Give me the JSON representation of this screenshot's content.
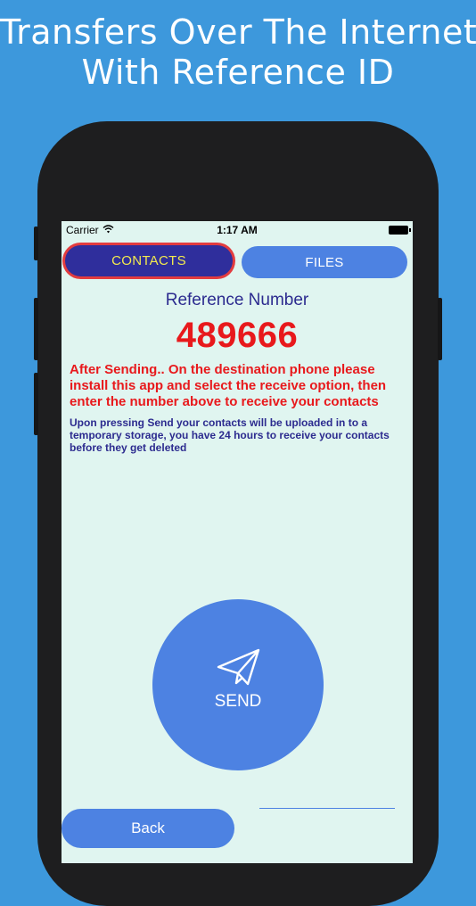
{
  "headline": {
    "line1": "Transfers Over The Internet",
    "line2": "With Reference ID"
  },
  "status_bar": {
    "carrier": "Carrier",
    "time": "1:17 AM"
  },
  "tabs": [
    {
      "label": "CONTACTS",
      "selected": true
    },
    {
      "label": "FILES",
      "selected": false
    }
  ],
  "reference": {
    "label": "Reference Number",
    "number": "489666"
  },
  "warning_text": "After Sending.. On the destination phone please install this app and select the receive option, then enter the number above to receive your contacts",
  "info_text": "Upon pressing Send your contacts will be uploaded in to a temporary storage, you have 24 hours to receive your contacts before they get deleted",
  "send_button": {
    "label": "SEND",
    "icon": "paper-plane-icon"
  },
  "back_button": {
    "label": "Back"
  },
  "colors": {
    "background": "#3d98dc",
    "screen": "#e0f5f0",
    "accent_blue": "#4d82e2",
    "selected_tab": "#2f2e9c",
    "selected_tab_text": "#f2e94e",
    "selected_tab_border": "#e23c3f",
    "alert_red": "#e8191c",
    "navy_text": "#2c2b8f"
  }
}
